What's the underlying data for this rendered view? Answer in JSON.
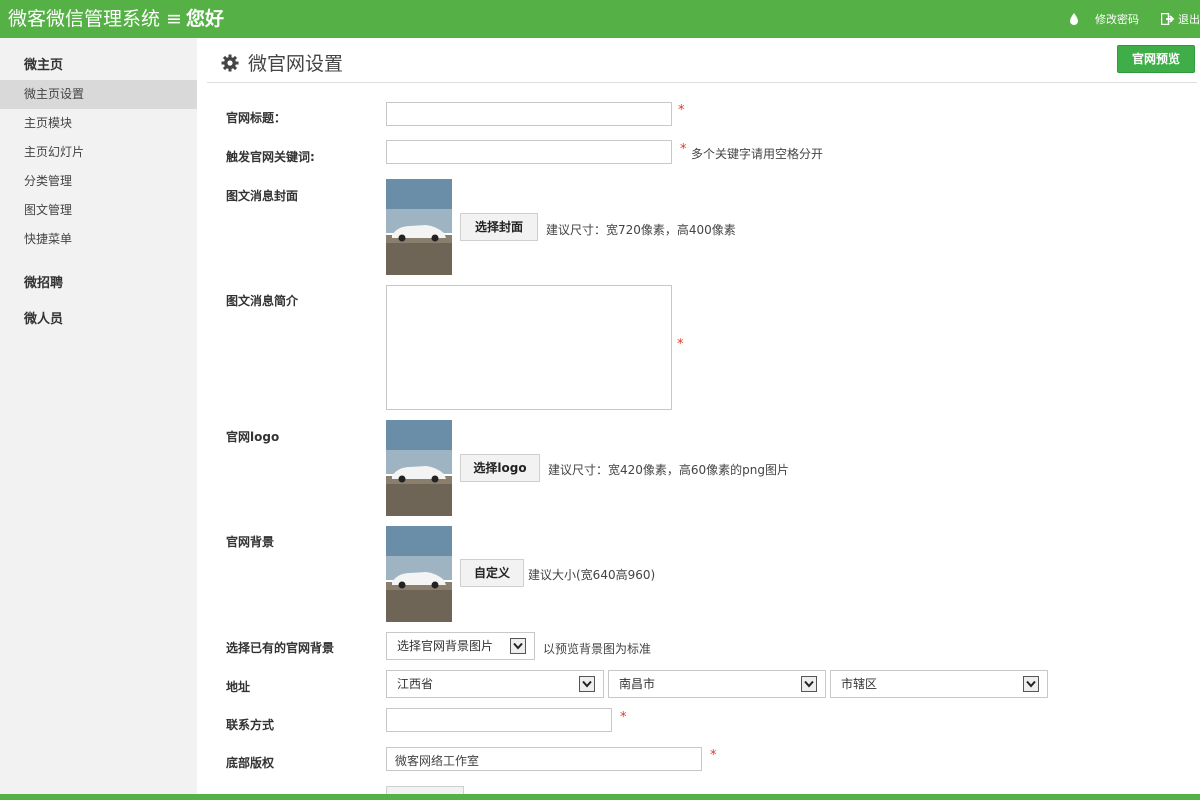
{
  "header": {
    "app_title": "微客微信管理系统",
    "menu_icon": "≡",
    "greeting": "您好",
    "change_password": "修改密码",
    "logout": "退出"
  },
  "sidebar": {
    "groups": [
      {
        "label": "微主页",
        "items": [
          "微主页设置",
          "主页模块",
          "主页幻灯片",
          "分类管理",
          "图文管理",
          "快捷菜单"
        ]
      },
      {
        "label": "微招聘",
        "items": []
      },
      {
        "label": "微人员",
        "items": []
      }
    ],
    "active_item": "微主页设置"
  },
  "page": {
    "title": "微官网设置",
    "preview_button": "官网预览"
  },
  "form": {
    "site_title": {
      "label": "官网标题：",
      "value": "",
      "required": "*"
    },
    "keywords": {
      "label": "触发官网关键词:",
      "value": "",
      "required": "*",
      "hint": "多个关键字请用空格分开"
    },
    "cover": {
      "label": "图文消息封面",
      "button": "选择封面",
      "hint": "建议尺寸：宽720像素，高400像素"
    },
    "summary": {
      "label": "图文消息简介",
      "value": "",
      "required": "*"
    },
    "logo": {
      "label": "官网logo",
      "button": "选择logo",
      "hint": "建议尺寸：宽420像素，高60像素的png图片"
    },
    "background": {
      "label": "官网背景",
      "button": "自定义",
      "hint": "建议大小(宽640高960)"
    },
    "existing_bg": {
      "label": "选择已有的官网背景",
      "selected": "选择官网背景图片",
      "hint": "以预览背景图为标准"
    },
    "address": {
      "label": "地址",
      "province": "江西省",
      "city": "南昌市",
      "district": "市辖区"
    },
    "contact": {
      "label": "联系方式",
      "value": "",
      "required": "*"
    },
    "copyright": {
      "label": "底部版权",
      "value": "微客网络工作室",
      "required": "*"
    }
  },
  "colors": {
    "brand_green": "#55b046",
    "button_green": "#3fae49",
    "required_red": "#e0371f"
  }
}
